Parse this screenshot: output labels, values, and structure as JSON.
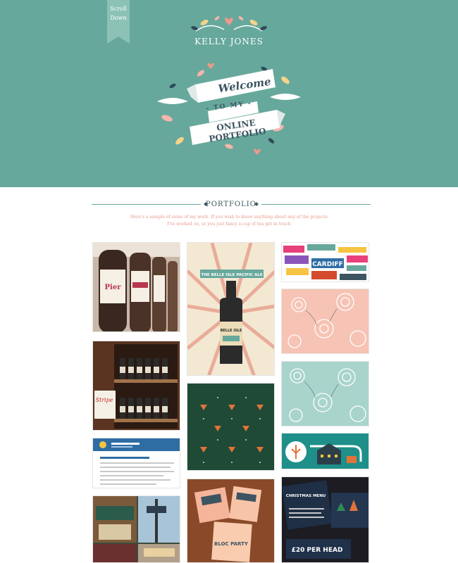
{
  "hero": {
    "scroll_tab": [
      "Scroll",
      "Down"
    ],
    "brand_name": "KELLY JONES",
    "banner": {
      "line1": "Welcome",
      "line2": "- TO MY -",
      "line3": "ONLINE PORTFOLIO"
    }
  },
  "portfolio": {
    "title": "PORTFOLIO",
    "intro_line1": "Here's a sample of some of my work. If you wish to know anything about any of the projects",
    "intro_line2": "I've worked on, or you just fancy a cup of tea get in touch",
    "tiles": [
      {
        "text": "Pier"
      },
      {
        "text": "THE BELLE ISLE PACIFIC ALE",
        "text2": "BELLE ISLE"
      },
      {
        "text": "CARDIFF"
      },
      {
        "text": "Stripe"
      },
      {
        "text": "£20 PER HEAD",
        "text2": "CHRISTMAS MENU"
      },
      {
        "text": "BLOC PARTY"
      }
    ]
  },
  "colors": {
    "hero_bg": "#67a89c",
    "navy": "#3d5561",
    "pink": "#e89a8c"
  }
}
